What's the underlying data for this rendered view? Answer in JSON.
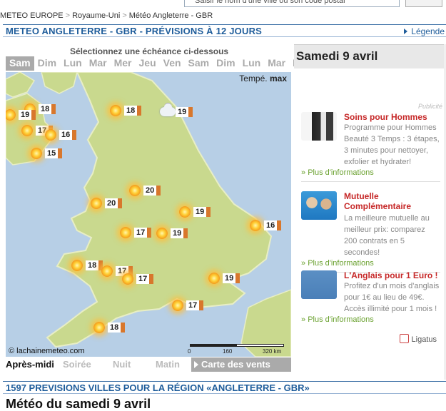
{
  "search": {
    "placeholder": "Saisir le nom d'une ville ou son code postal"
  },
  "breadcrumb": [
    "METEO EUROPE",
    "Royaume-Uni",
    "Météo Angleterre - GBR"
  ],
  "header": {
    "title": "METEO ANGLETERRE - GBR - PRÉVISIONS À 12 JOURS",
    "legend_link": "Légende"
  },
  "selector": {
    "instruction": "Sélectionnez une échéance ci-dessous",
    "days": [
      "Sam",
      "Dim",
      "Lun",
      "Mar",
      "Mer",
      "Jeu",
      "Ven",
      "Sam",
      "Dim",
      "Lun",
      "Mar",
      "Mer"
    ],
    "active_index": 0
  },
  "map": {
    "temp_label_prefix": "Tempé.",
    "temp_label_mode": "max",
    "copyright": "© lachainemeteo.com",
    "scale": [
      "0",
      "160",
      "320 km"
    ],
    "markers": [
      {
        "icon": "sun",
        "value": "18"
      },
      {
        "icon": "sun",
        "value": "19"
      },
      {
        "icon": "sun",
        "value": "17"
      },
      {
        "icon": "sun",
        "value": "16"
      },
      {
        "icon": "sun",
        "value": "15"
      },
      {
        "icon": "sun",
        "value": "18"
      },
      {
        "icon": "cloud",
        "value": "19"
      },
      {
        "icon": "sun",
        "value": "20"
      },
      {
        "icon": "sun",
        "value": "20"
      },
      {
        "icon": "sun",
        "value": "19"
      },
      {
        "icon": "sun",
        "value": "17"
      },
      {
        "icon": "sun",
        "value": "19"
      },
      {
        "icon": "sun",
        "value": "16"
      },
      {
        "icon": "sun",
        "value": "18"
      },
      {
        "icon": "sun",
        "value": "17"
      },
      {
        "icon": "sun",
        "value": "17"
      },
      {
        "icon": "sun",
        "value": "19"
      },
      {
        "icon": "sun",
        "value": "17"
      },
      {
        "icon": "sun",
        "value": "18"
      }
    ]
  },
  "periods": {
    "items": [
      "Après-midi",
      "Soirée",
      "Nuit",
      "Matin"
    ],
    "active_index": 0,
    "winds_button": "Carte des vents"
  },
  "sidebar": {
    "date": "Samedi 9 avril",
    "publicite": "Publicité",
    "ads": [
      {
        "title": "Soins pour Hommes",
        "text": "Programme pour Hommes Beauté 3 Temps : 3 étapes, 3 minutes pour nettoyer, exfolier et hydrater!",
        "more": "Plus d'informations"
      },
      {
        "title": "Mutuelle Complémentaire",
        "text": "La meilleure mutuelle au meilleur prix: comparez 200 contrats en 5 secondes!",
        "more": "Plus d'informations"
      },
      {
        "title": "L'Anglais pour 1 Euro !",
        "text": "Profitez d'un mois d'anglais pour 1€ au lieu de 49€. Accès illimité pour 1 mois !",
        "more": "Plus d'informations"
      }
    ],
    "ligatus": "Ligatus"
  },
  "footer": {
    "heading": "1597 PREVISIONS VILLES POUR LA RÉGION «ANGLETERRE - GBR»",
    "subheading": "Météo du samedi 9 avril"
  },
  "colors": {
    "accent": "#1f5d9b",
    "ad_title": "#c62828",
    "more_link": "#6aa12f",
    "sea": "#b7cfe6",
    "land": "#c9d98e"
  }
}
